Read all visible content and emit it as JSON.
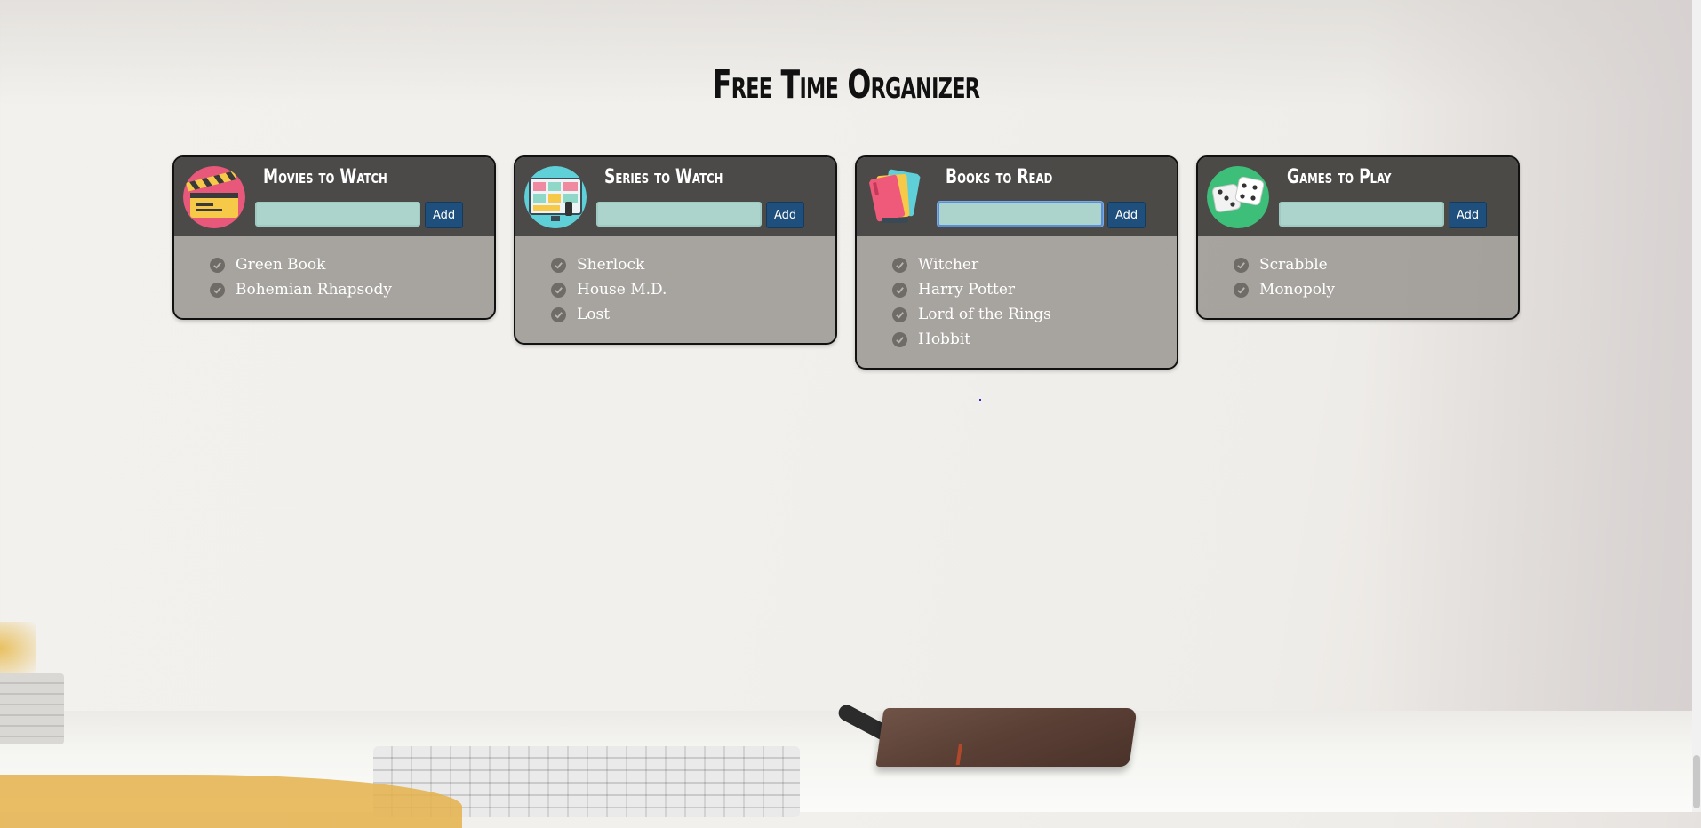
{
  "page": {
    "title": "Free Time Organizer"
  },
  "colors": {
    "header": "#444240",
    "body": "#96938e",
    "input": "#acd3cc",
    "button": "#1f4f7c"
  },
  "add_label": "Add",
  "cards": [
    {
      "title": "Movies to Watch",
      "icon": "clapperboard-icon",
      "input_value": "",
      "items": [
        "Green Book",
        "Bohemian Rhapsody"
      ]
    },
    {
      "title": "Series to Watch",
      "icon": "tv-icon",
      "input_value": "",
      "items": [
        "Sherlock",
        "House M.D.",
        "Lost"
      ]
    },
    {
      "title": "Books to Read",
      "icon": "books-icon",
      "input_value": "",
      "items": [
        "Witcher",
        "Harry Potter",
        "Lord of the Rings",
        "Hobbit"
      ]
    },
    {
      "title": "Games to Play",
      "icon": "dice-icon",
      "input_value": "",
      "items": [
        "Scrabble",
        "Monopoly"
      ]
    }
  ]
}
